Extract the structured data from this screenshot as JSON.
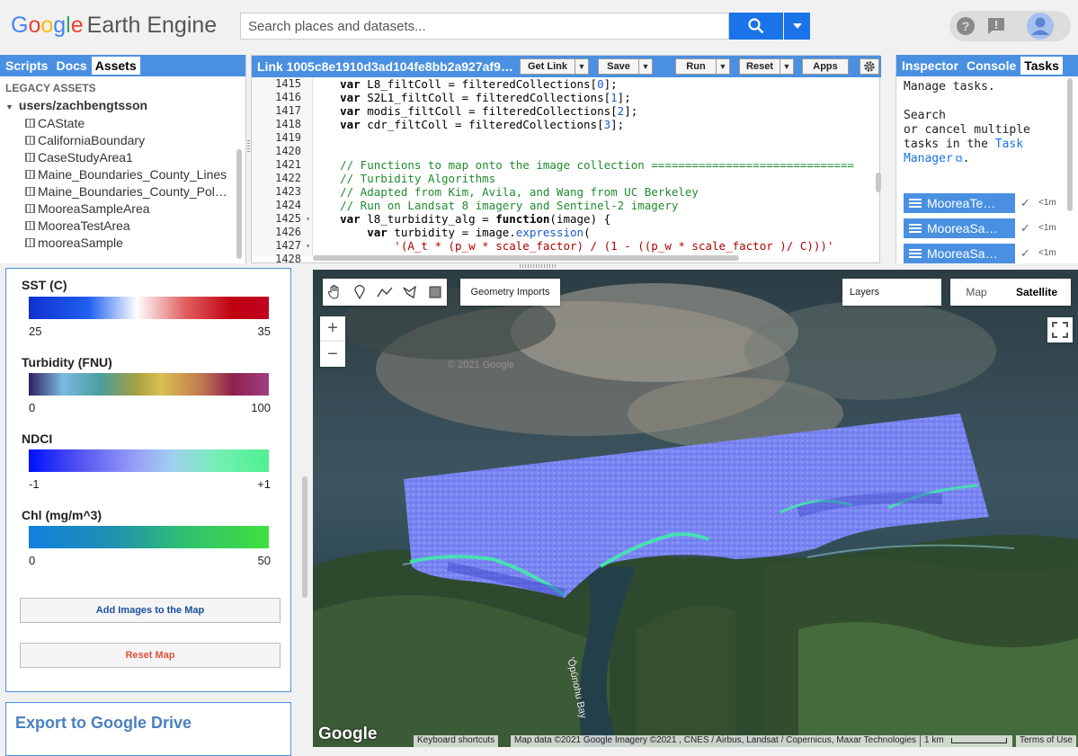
{
  "header": {
    "logo_google": [
      "G",
      "o",
      "o",
      "g",
      "l",
      "e"
    ],
    "logo_product": "Earth Engine",
    "search_placeholder": "Search places and datasets..."
  },
  "left_tabs": [
    "Scripts",
    "Docs",
    "Assets"
  ],
  "assets": {
    "section": "LEGACY ASSETS",
    "root": "users/zachbengtsson",
    "items": [
      "CAState",
      "CaliforniaBoundary",
      "CaseStudyArea1",
      "Maine_Boundaries_County_Lines",
      "Maine_Boundaries_County_Pol…",
      "MooreaSampleArea",
      "MooreaTestArea",
      "mooreaSample"
    ]
  },
  "editor": {
    "title": "Link 1005c8e1910d3ad104fe8bb2a927af9…",
    "buttons": {
      "get_link": "Get Link",
      "save": "Save",
      "run": "Run",
      "reset": "Reset",
      "apps": "Apps"
    },
    "line_numbers": [
      "1415",
      "1416",
      "1417",
      "1418",
      "1419",
      "1420",
      "1421",
      "1422",
      "1423",
      "1424",
      "1425",
      "1426",
      "1427",
      "1428"
    ],
    "fold_marks": [
      "",
      "",
      "",
      "",
      "",
      "",
      "",
      "",
      "",
      "",
      "▾",
      "",
      "▾",
      ""
    ]
  },
  "right_tabs": [
    "Inspector",
    "Console",
    "Tasks"
  ],
  "tasks": {
    "line1": "Manage tasks.",
    "line2": "Search",
    "line3": "or cancel multiple",
    "line4_prefix": "tasks in the ",
    "link1": "Task",
    "link2": "Manager",
    "suffix": ".",
    "items": [
      {
        "name": "MooreaTe…",
        "time": "<1m"
      },
      {
        "name": "MooreaSa…",
        "time": "<1m"
      },
      {
        "name": "MooreaSa…",
        "time": "<1m"
      }
    ]
  },
  "legends": [
    {
      "title": "SST (C)",
      "min": "25",
      "max": "35"
    },
    {
      "title": "Turbidity (FNU)",
      "min": "0",
      "max": "100"
    },
    {
      "title": "NDCI",
      "min": "-1",
      "max": "+1"
    },
    {
      "title": "Chl (mg/m^3)",
      "min": "0",
      "max": "50"
    }
  ],
  "buttons": {
    "add_images": "Add Images to the Map",
    "reset_map": "Reset Map"
  },
  "export_title": "Export to Google Drive",
  "map": {
    "geometry_imports": "Geometry Imports",
    "layers": "Layers",
    "map_type_map": "Map",
    "map_type_satellite": "Satellite",
    "zoom_in": "+",
    "zoom_out": "−",
    "watermark": "© 2021 Google",
    "bay_label": "'Ōpūnohu Bay",
    "google_logo": "Google",
    "keyboard_shortcuts": "Keyboard shortcuts",
    "map_data": "Map data ©2021 Google Imagery ©2021 , CNES / Airbus, Landsat / Copernicus, Maxar Technologies",
    "scale": "1 km",
    "terms": "Terms of Use"
  },
  "colors": {
    "accent": "#4a90e2",
    "search_blue": "#1a73e8",
    "reset_red": "#e0523c"
  }
}
